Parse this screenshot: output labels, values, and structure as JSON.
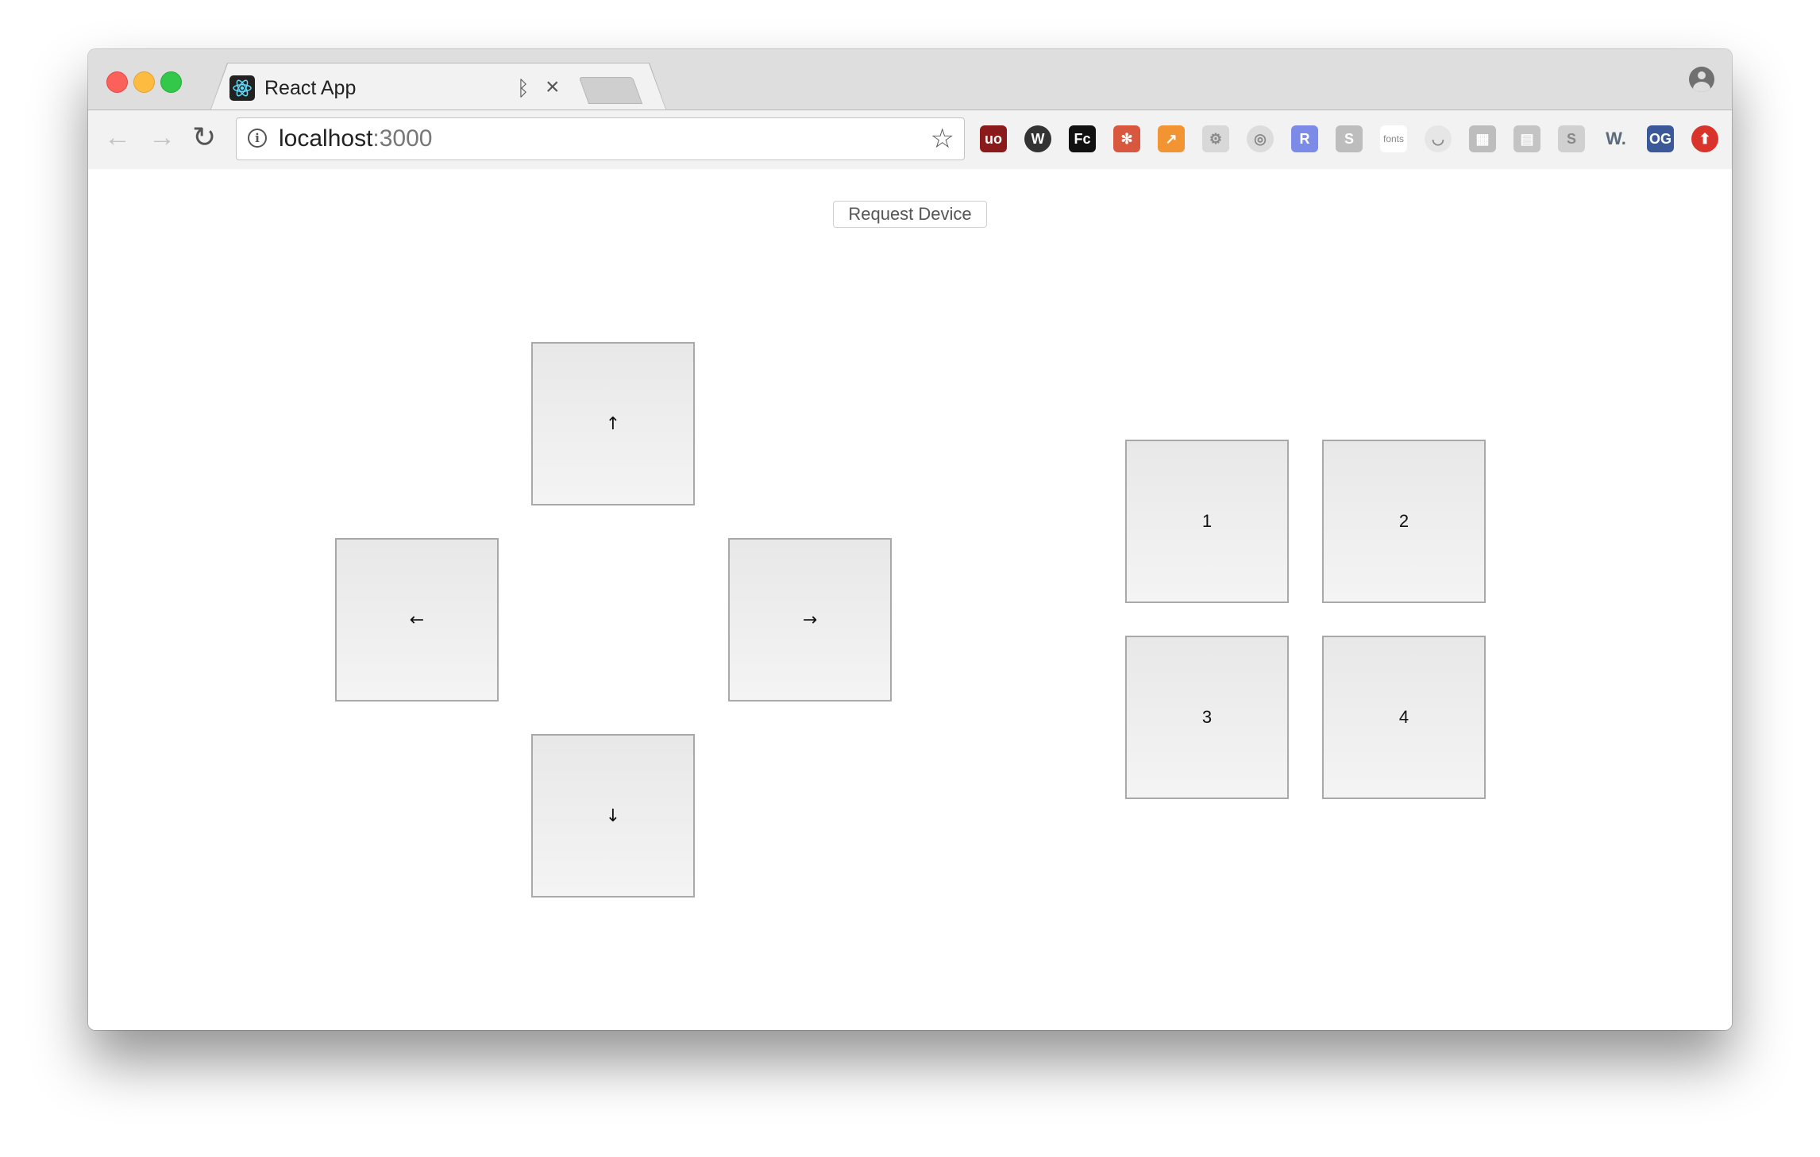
{
  "browser": {
    "tab_title": "React App",
    "tab_close": "×",
    "bluetooth_icon": "ᛒ",
    "url_host": "localhost",
    "url_port": ":3000",
    "nav": {
      "back": "←",
      "forward": "→",
      "reload": "↻"
    },
    "star": "☆",
    "info": "i",
    "extensions": [
      {
        "name": "ublock-icon",
        "label": "uo",
        "color": "#8b1a1a"
      },
      {
        "name": "wappalyzer-icon",
        "label": "W",
        "color": "#333333"
      },
      {
        "name": "fc-icon",
        "label": "Fc",
        "color": "#111111"
      },
      {
        "name": "react-devtools-icon",
        "label": "✻",
        "color": "#d9573f"
      },
      {
        "name": "analytics-icon",
        "label": "↗",
        "color": "#f29432"
      },
      {
        "name": "gear-ext-icon",
        "label": "⚙",
        "color": "#d8d8d8"
      },
      {
        "name": "target-ext-icon",
        "label": "◎",
        "color": "#dcdcdc"
      },
      {
        "name": "redux-r-icon",
        "label": "R",
        "color": "#7d8be8"
      },
      {
        "name": "skype-icon",
        "label": "S",
        "color": "#bdbdbd"
      },
      {
        "name": "fonts-icon",
        "label": "fonts",
        "color": "#ffffff"
      },
      {
        "name": "face-ext-icon",
        "label": "◡",
        "color": "#e6e6e6"
      },
      {
        "name": "image-ext-icon",
        "label": "▦",
        "color": "#bdbdbd"
      },
      {
        "name": "chart-ext-icon",
        "label": "▤",
        "color": "#c4c4c4"
      },
      {
        "name": "s-ext-icon",
        "label": "S",
        "color": "#d0d0d0"
      },
      {
        "name": "w-ext-icon",
        "label": "W.",
        "color": "#f2f2f2"
      },
      {
        "name": "og-icon",
        "label": "OG",
        "color": "#3b5998"
      },
      {
        "name": "upload-ext-icon",
        "label": "⬆",
        "color": "#d9342b"
      }
    ]
  },
  "app": {
    "request_button": "Request Device",
    "dpad": {
      "up": "↑",
      "left": "←",
      "right": "→",
      "down": "↓"
    },
    "numpad": [
      "1",
      "2",
      "3",
      "4"
    ]
  }
}
